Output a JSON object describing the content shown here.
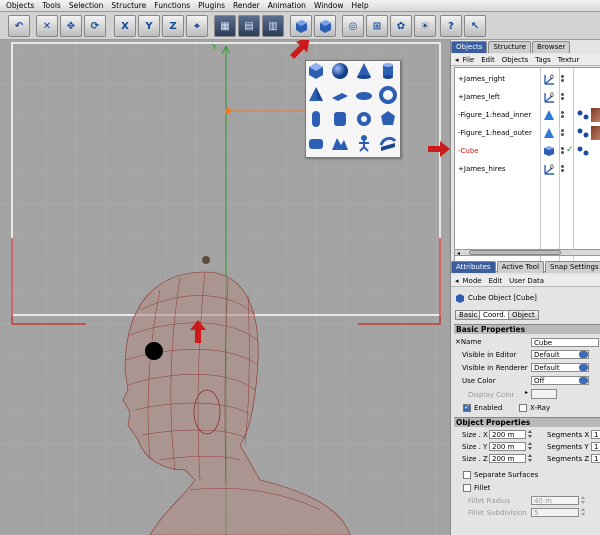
{
  "menu": [
    "Objects",
    "Tools",
    "Selection",
    "Structure",
    "Functions",
    "Plugins",
    "Render",
    "Animation",
    "Window",
    "Help"
  ],
  "toolbar": {
    "axis_x": "X",
    "axis_y": "Y",
    "axis_z": "Z"
  },
  "viewport": {
    "axis_label": "Y",
    "colors": {
      "grid_axis_green": "#2f9a2f",
      "axis_orange": "#f07a20",
      "frame_red": "#d22020",
      "mesh": "#8a2e2e"
    }
  },
  "palette": {
    "icons": [
      "cube-icon",
      "sphere-icon",
      "cone-icon",
      "cylinder-icon",
      "pyramid-icon",
      "plane-icon",
      "disc-icon",
      "torus-icon",
      "capsule-icon",
      "oil-tank-icon",
      "tube-icon",
      "platonic-icon",
      "figure-icon",
      "landscape-icon",
      "relief-icon",
      "bezier-icon"
    ]
  },
  "object_manager": {
    "tabs": [
      "Objects",
      "Structure",
      "Browser"
    ],
    "menu": [
      "File",
      "Edit",
      "Objects",
      "Tags",
      "Textur"
    ],
    "rows": [
      {
        "name": "James_right",
        "prefix": "+",
        "highlight": false
      },
      {
        "name": "James_left",
        "prefix": "+",
        "highlight": false
      },
      {
        "name": "Figure_1:head_inner",
        "prefix": "-",
        "highlight": false
      },
      {
        "name": "Figure_1:head_outer",
        "prefix": "-",
        "highlight": false
      },
      {
        "name": "Cube",
        "prefix": "-",
        "highlight": true
      },
      {
        "name": "James_hires",
        "prefix": "+",
        "highlight": false
      }
    ]
  },
  "attributes": {
    "tabs": [
      "Attributes",
      "Active Tool",
      "Snap Settings"
    ],
    "menu": [
      "Mode",
      "Edit",
      "User Data"
    ],
    "object_title": "Cube Object [Cube]",
    "subtabs": [
      "Basic",
      "Coord.",
      "Object"
    ],
    "basic_header": "Basic Properties",
    "name_label": "Name",
    "name_value": "Cube",
    "visible_editor_label": "Visible in Editor",
    "visible_editor_value": "Default",
    "visible_renderer_label": "Visible in Renderer",
    "visible_renderer_value": "Default",
    "use_color_label": "Use Color",
    "use_color_value": "Off",
    "display_color_label": "Display Color",
    "enabled_label": "Enabled",
    "xray_label": "X-Ray",
    "object_header": "Object Properties",
    "size_x_label": "Size . X",
    "size_x_value": "200 m",
    "size_y_label": "Size . Y",
    "size_y_value": "200 m",
    "size_z_label": "Size . Z",
    "size_z_value": "200 m",
    "seg_x_label": "Segments X",
    "seg_x_value": "1",
    "seg_y_label": "Segments Y",
    "seg_y_value": "1",
    "seg_z_label": "Segments Z",
    "seg_z_value": "1",
    "separate_label": "Separate Surfaces",
    "fillet_label": "Fillet",
    "fillet_radius_label": "Fillet Radius",
    "fillet_radius_value": "40 m",
    "fillet_sub_label": "Fillet Subdivision",
    "fillet_sub_value": "5"
  }
}
